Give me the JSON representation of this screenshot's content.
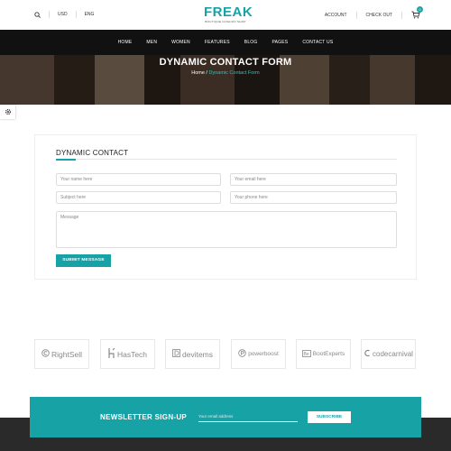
{
  "topbar": {
    "currency": "USD",
    "language": "ENG",
    "account": "ACCOUNT",
    "checkout": "CHECK OUT",
    "cart_count": "0"
  },
  "logo": {
    "name": "FREAK",
    "tagline": "BOUTIQUE FASHION SHOP"
  },
  "nav": [
    "HOME",
    "MEN",
    "WOMEN",
    "FEATURES",
    "BLOG",
    "PAGES",
    "CONTACT US"
  ],
  "hero": {
    "title": "DYNAMIC CONTACT FORM",
    "breadcrumb_home": "Home",
    "breadcrumb_sep": " / ",
    "breadcrumb_current": "Dynamic Contact Form"
  },
  "contact": {
    "title": "DYNAMIC CONTACT",
    "name_placeholder": "Your name here",
    "email_placeholder": "Your email here",
    "subject_placeholder": "Subject here",
    "phone_placeholder": "Your phone here",
    "message_placeholder": "Message",
    "submit_label": "SUBMIT MESSAGE"
  },
  "brands": [
    {
      "name": "RightSell",
      "icon": "circle-c-icon"
    },
    {
      "name": "HasTech",
      "icon": "h-icon"
    },
    {
      "name": "devitems",
      "icon": "d-box-icon"
    },
    {
      "name": "powerboost",
      "icon": "p-circle-icon"
    },
    {
      "name": "BootExperts",
      "icon": "be-box-icon"
    },
    {
      "name": "codecarnival",
      "icon": "c-icon"
    }
  ],
  "newsletter": {
    "title": "NEWSLETTER SIGN-UP",
    "placeholder": "Your email address",
    "button": "SUBSCRIBE"
  },
  "colors": {
    "accent": "#17a2a6",
    "nav_bg": "#111111",
    "footer_bg": "#2a2a2a"
  }
}
